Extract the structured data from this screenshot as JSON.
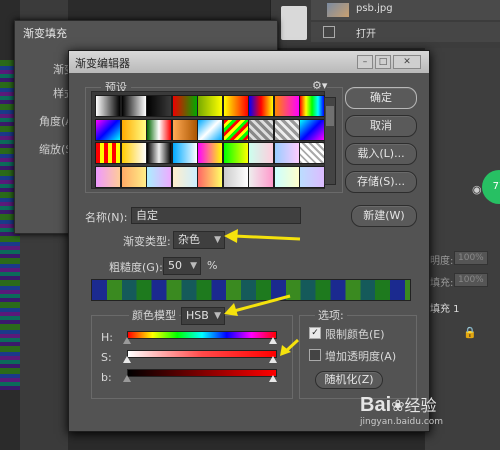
{
  "workspace": {
    "layer_name": "psb.jpg",
    "layer2_label": "打开",
    "right_lbl_opacity": "明度:",
    "right_lbl_fill": "填充:",
    "right_val_opacity": "100%",
    "right_val_fill": "100%",
    "fill_layer_label": "填充 1",
    "green_badge": "77"
  },
  "fill_dialog": {
    "title": "渐变填充",
    "label_gradient": "渐变",
    "label_style": "样式",
    "label_angle": "角度(A)",
    "label_scale": "缩放(S)"
  },
  "editor": {
    "title": "渐变编辑器",
    "presets_label": "预设",
    "gear_icon": "gear-icon",
    "buttons": {
      "ok": "确定",
      "cancel": "取消",
      "load": "载入(L)...",
      "save": "存储(S)...",
      "new": "新建(W)"
    },
    "name_label": "名称(N):",
    "name_value": "自定",
    "gradient_type_label": "渐变类型:",
    "gradient_type_value": "杂色",
    "roughness_label": "粗糙度(G):",
    "roughness_value": "50",
    "roughness_unit": "%",
    "color_model_label": "颜色模型",
    "color_model_value": "HSB",
    "channel_h": "H:",
    "channel_s": "S:",
    "channel_b": "b:",
    "options_label": "选项:",
    "option_restrict": "限制颜色(E)",
    "option_restrict_checked": true,
    "option_transparency": "增加透明度(A)",
    "option_transparency_checked": false,
    "randomize_button": "随机化(Z)"
  },
  "watermark": {
    "brand": "Bai",
    "brand2": "经验",
    "url": "jingyan.baidu.com"
  },
  "colors": {
    "highlight_arrow": "#f5e20c",
    "dialog_bg": "#535353",
    "titlebar": "#cfcfcf"
  }
}
